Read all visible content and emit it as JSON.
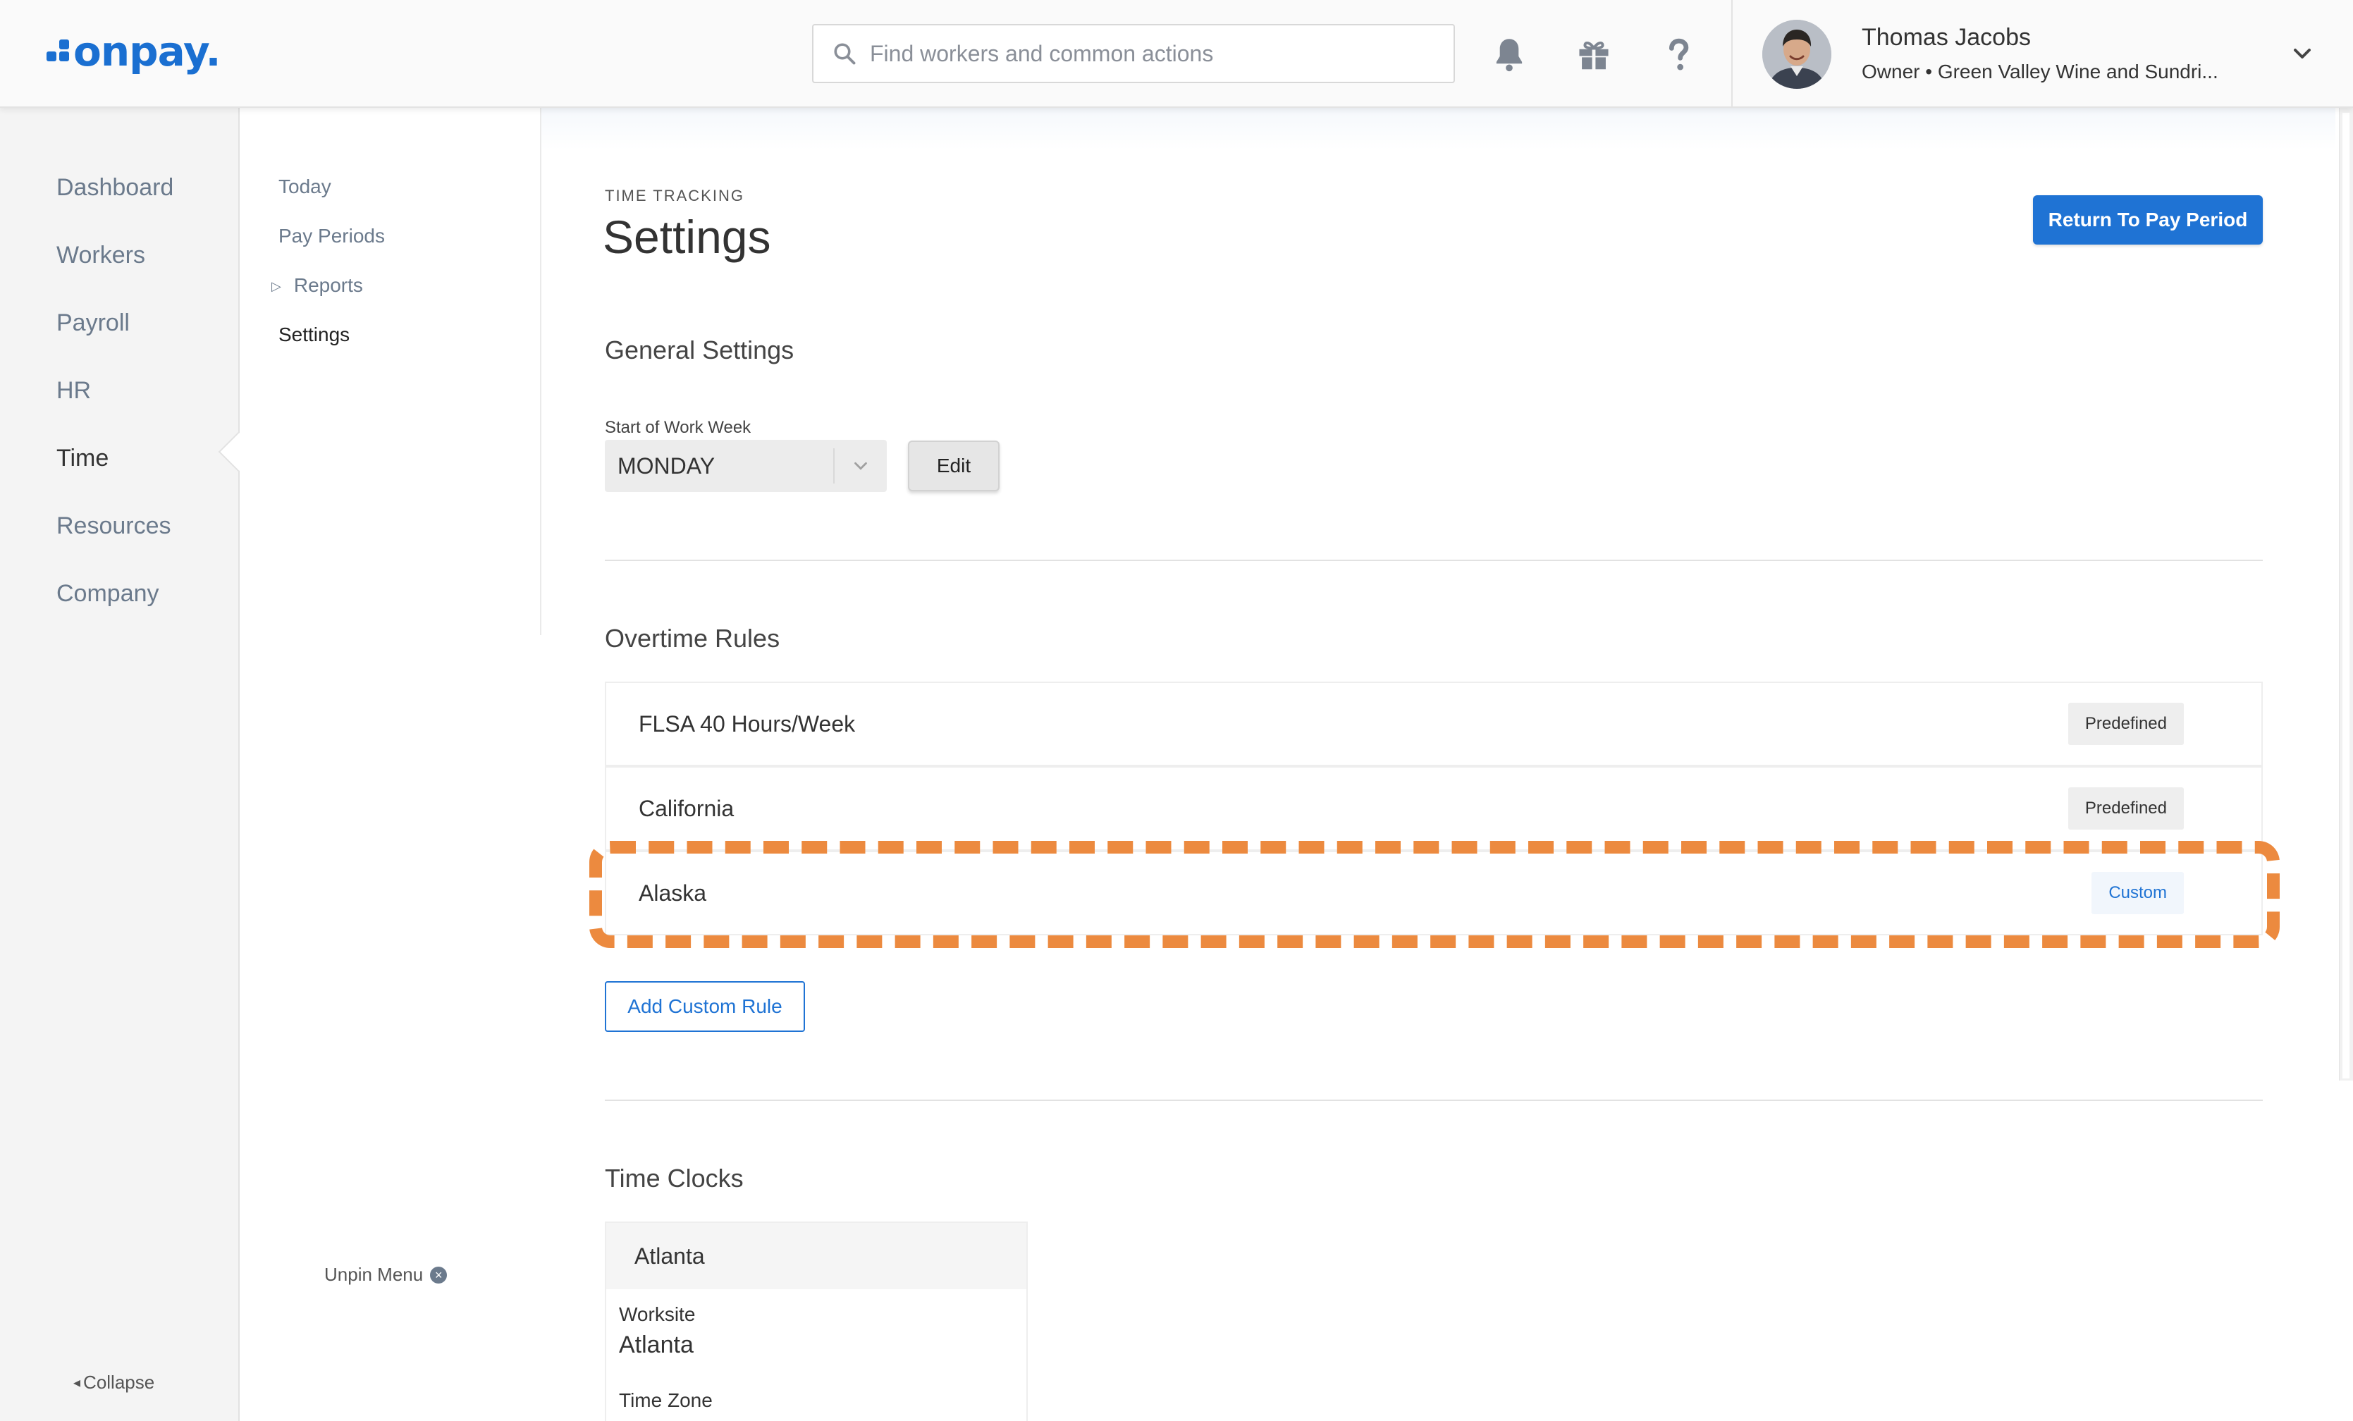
{
  "header": {
    "brand": "onpay.",
    "search_placeholder": "Find workers and common actions",
    "user_name": "Thomas Jacobs",
    "user_role": "Owner • Green Valley Wine and Sundri...",
    "icons": [
      "bell-icon",
      "gift-icon",
      "help-icon",
      "chevron-down-icon"
    ]
  },
  "nav": {
    "items": [
      "Dashboard",
      "Workers",
      "Payroll",
      "HR",
      "Time",
      "Resources",
      "Company"
    ],
    "active": "Time",
    "collapse_label": "Collapse"
  },
  "subnav": {
    "items": [
      "Today",
      "Pay Periods",
      "Reports",
      "Settings"
    ],
    "active": "Settings",
    "unpin_label": "Unpin Menu"
  },
  "page": {
    "eyebrow": "TIME TRACKING",
    "title": "Settings",
    "return_button": "Return To Pay Period"
  },
  "general": {
    "title": "General Settings",
    "week_label": "Start of Work Week",
    "week_value": "MONDAY",
    "edit_button": "Edit"
  },
  "overtime": {
    "title": "Overtime Rules",
    "rules": [
      {
        "name": "FLSA 40 Hours/Week",
        "badge": "Predefined"
      },
      {
        "name": "California",
        "badge": "Predefined"
      },
      {
        "name": "Alaska",
        "badge": "Custom"
      }
    ],
    "add_button": "Add Custom Rule"
  },
  "time_clocks": {
    "title": "Time Clocks",
    "card_title": "Atlanta",
    "worksite_label": "Worksite",
    "worksite_value": "Atlanta",
    "timezone_label": "Time Zone"
  },
  "colors": {
    "brand": "#1a6fd1",
    "primary": "#1f73d4",
    "highlight": "#ec8a3f"
  }
}
